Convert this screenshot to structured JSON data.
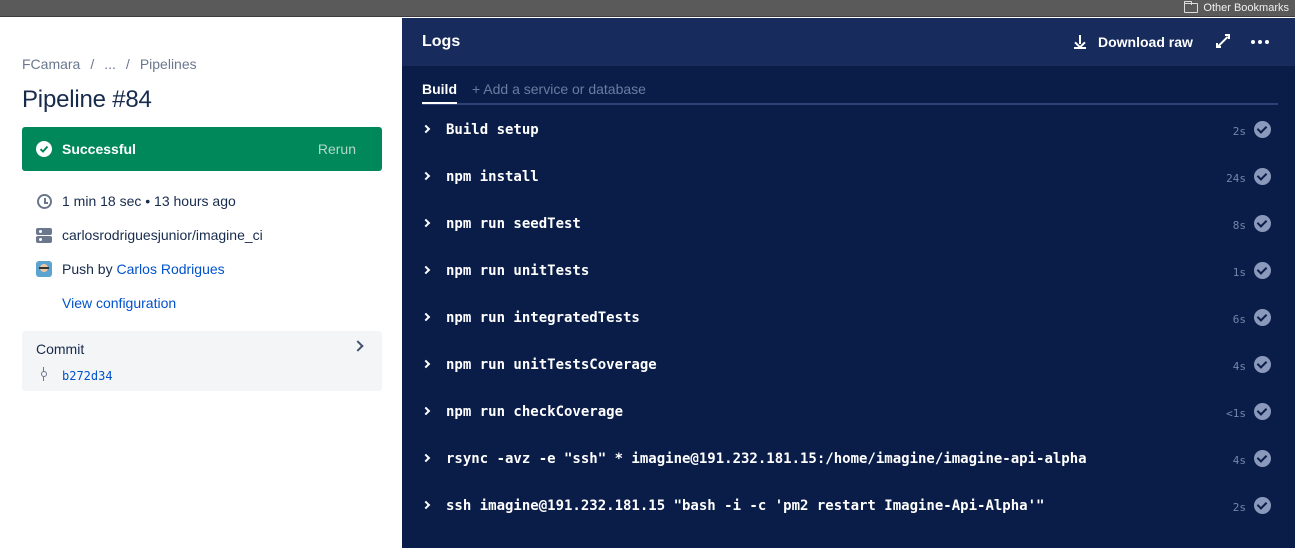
{
  "browser": {
    "bookmark_label": "Other Bookmarks"
  },
  "breadcrumb": {
    "items": [
      "FCamara",
      "...",
      "Pipelines"
    ],
    "separator": "/"
  },
  "pipeline": {
    "title": "Pipeline #84",
    "status": "Successful",
    "rerun_label": "Rerun",
    "status_color": "#00875a",
    "duration_text": "1 min 18 sec • 13 hours ago",
    "repository": "carlosrodriguesjunior/imagine_ci",
    "push_prefix": "Push by",
    "author": "Carlos Rodrigues",
    "view_config_label": "View configuration"
  },
  "commit": {
    "label": "Commit",
    "hash": "b272d34"
  },
  "logs": {
    "title": "Logs",
    "download_label": "Download raw",
    "tabs": {
      "build": "Build",
      "add_service": "+ Add a service or database"
    },
    "steps": [
      {
        "name": "Build setup",
        "duration": "2s"
      },
      {
        "name": "npm install",
        "duration": "24s"
      },
      {
        "name": "npm run seedTest",
        "duration": "8s"
      },
      {
        "name": "npm run unitTests",
        "duration": "1s"
      },
      {
        "name": "npm run integratedTests",
        "duration": "6s"
      },
      {
        "name": "npm run unitTestsCoverage",
        "duration": "4s"
      },
      {
        "name": "npm run checkCoverage",
        "duration": "<1s"
      },
      {
        "name": "rsync -avz -e \"ssh\" * imagine@191.232.181.15:/home/imagine/imagine-api-alpha",
        "duration": "4s"
      },
      {
        "name": "ssh imagine@191.232.181.15 \"bash -i -c 'pm2 restart Imagine-Api-Alpha'\"",
        "duration": "2s"
      }
    ]
  }
}
